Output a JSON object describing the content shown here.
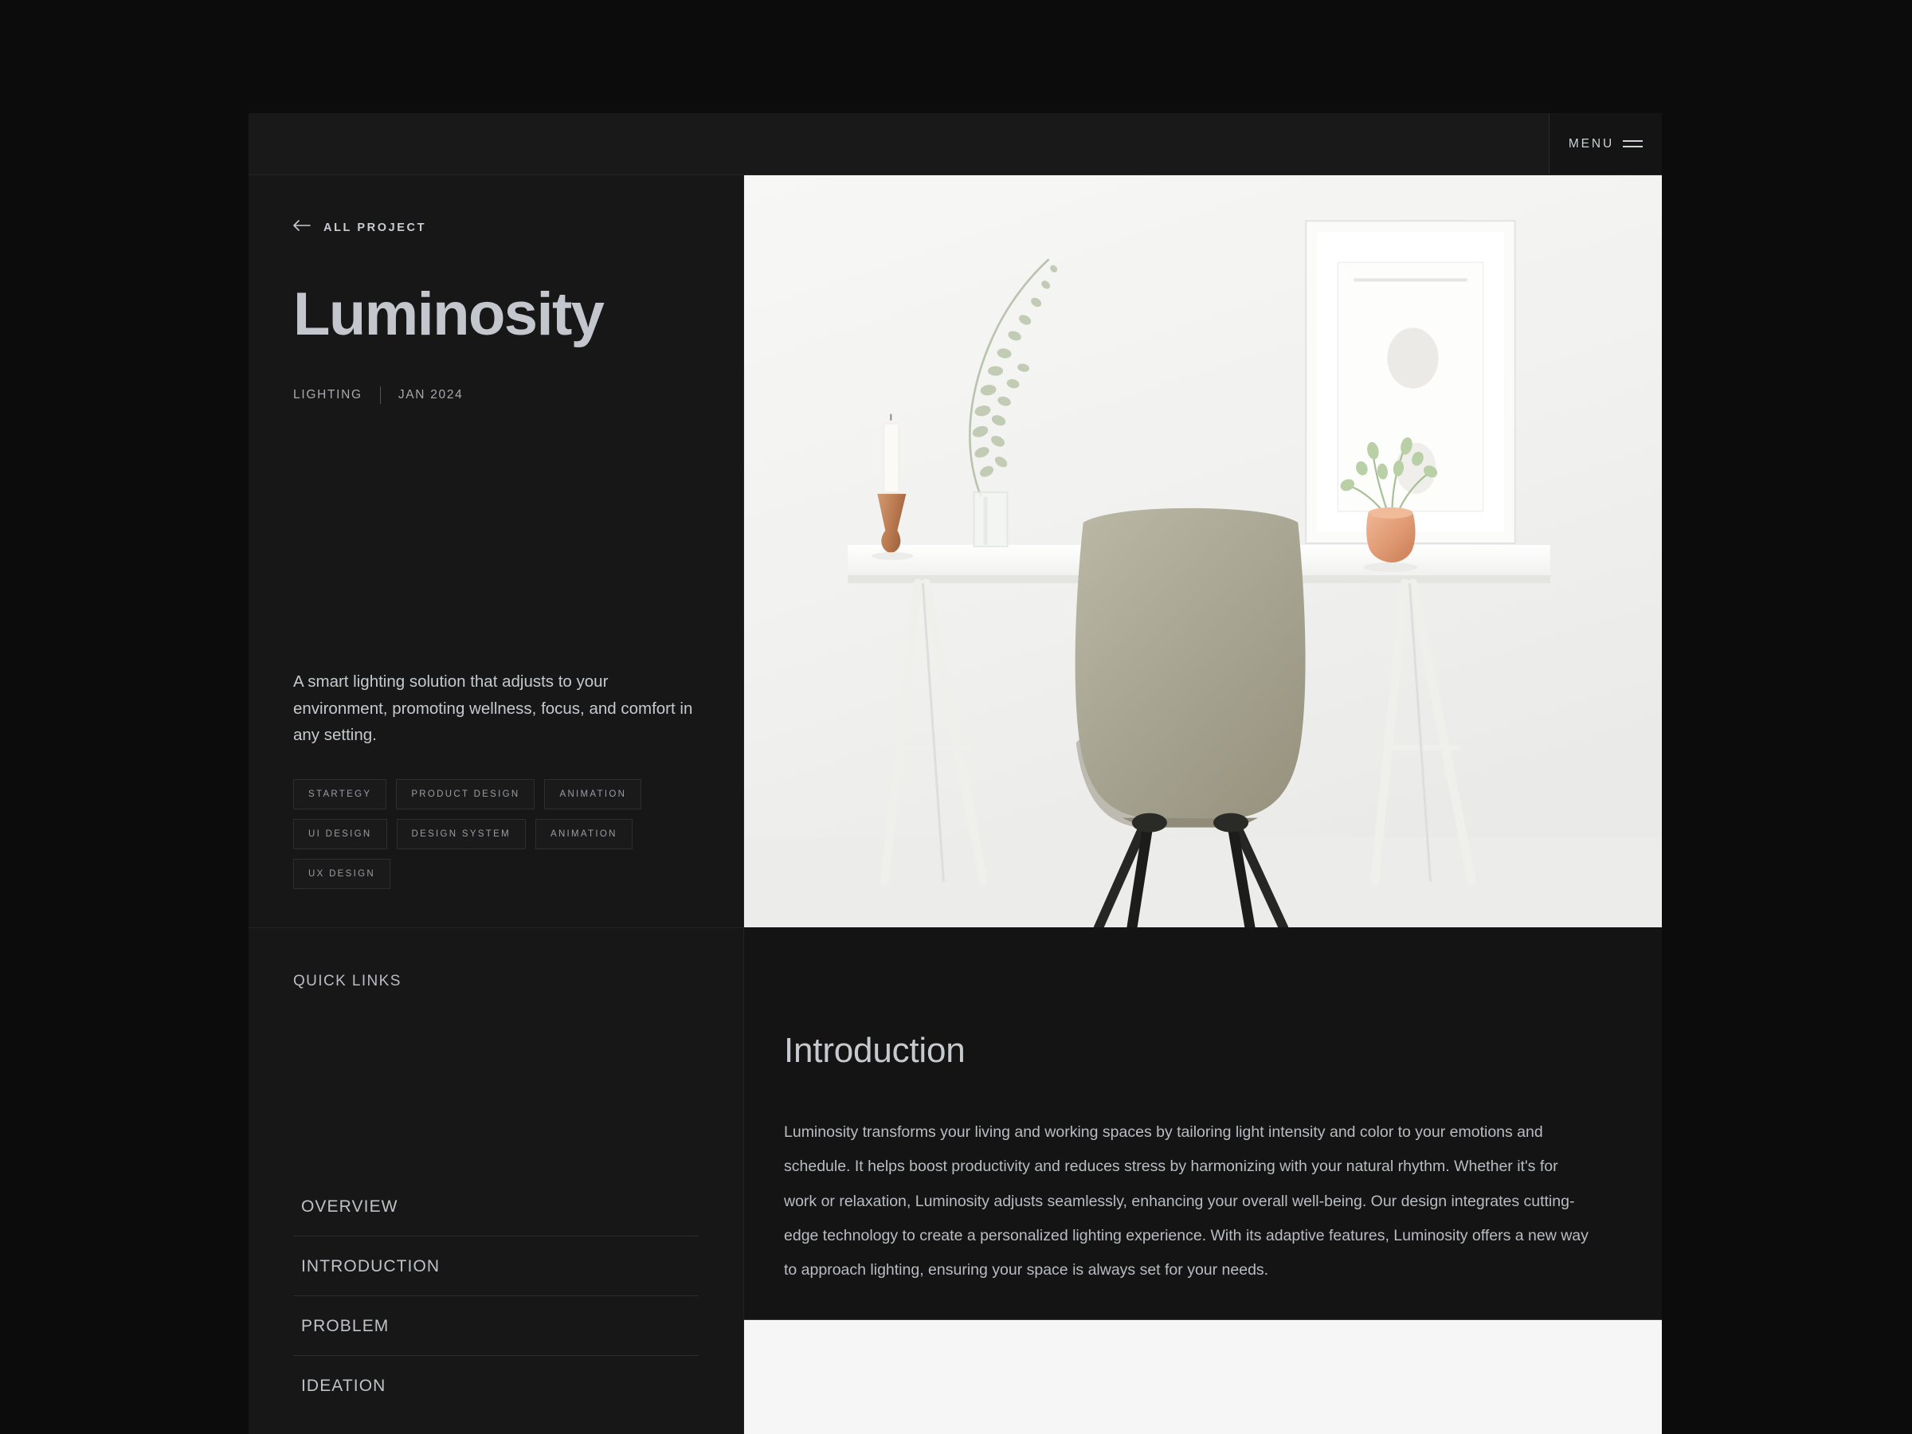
{
  "header": {
    "menu_label": "MENU",
    "menu_icon": "hamburger-icon"
  },
  "project": {
    "back_label": "ALL PROJECT",
    "back_icon": "arrow-left-icon",
    "title": "Luminosity",
    "category": "LIGHTING",
    "date": "JAN 2024",
    "description": "A smart lighting solution that adjusts to your environment, promoting wellness, focus, and comfort in any setting.",
    "tags": [
      "STARTEGY",
      "PRODUCT DESIGN",
      "ANIMATION",
      "UI DESIGN",
      "DESIGN SYSTEM",
      "ANIMATION",
      "UX DESIGN"
    ]
  },
  "quick_links": {
    "title": "QUICK LINKS",
    "items": [
      "OVERVIEW",
      "INTRODUCTION",
      "PROBLEM",
      "IDEATION"
    ]
  },
  "hero": {
    "alt": "minimalist white desk with chair, candle, eucalyptus stem, framed artwork and copper vase"
  },
  "introduction": {
    "heading": "Introduction",
    "body": "Luminosity transforms your living and working spaces by tailoring light intensity and color to your emotions and schedule. It helps boost productivity and reduces stress by harmonizing with your natural rhythm. Whether it's for work or relaxation, Luminosity adjusts seamlessly, enhancing your overall well-being. Our design integrates cutting-edge technology to create a personalized lighting experience. With its adaptive features, Luminosity offers a new way to approach lighting, ensuring your space is always set for your needs."
  },
  "colors": {
    "page_background": "#0c0c0c",
    "panel_background": "#171717",
    "content_background": "#141414",
    "text_primary": "#c6c9ce",
    "text_muted": "#9a9da2",
    "border": "#2b2b2b",
    "light_panel": "#f6f6f6"
  }
}
